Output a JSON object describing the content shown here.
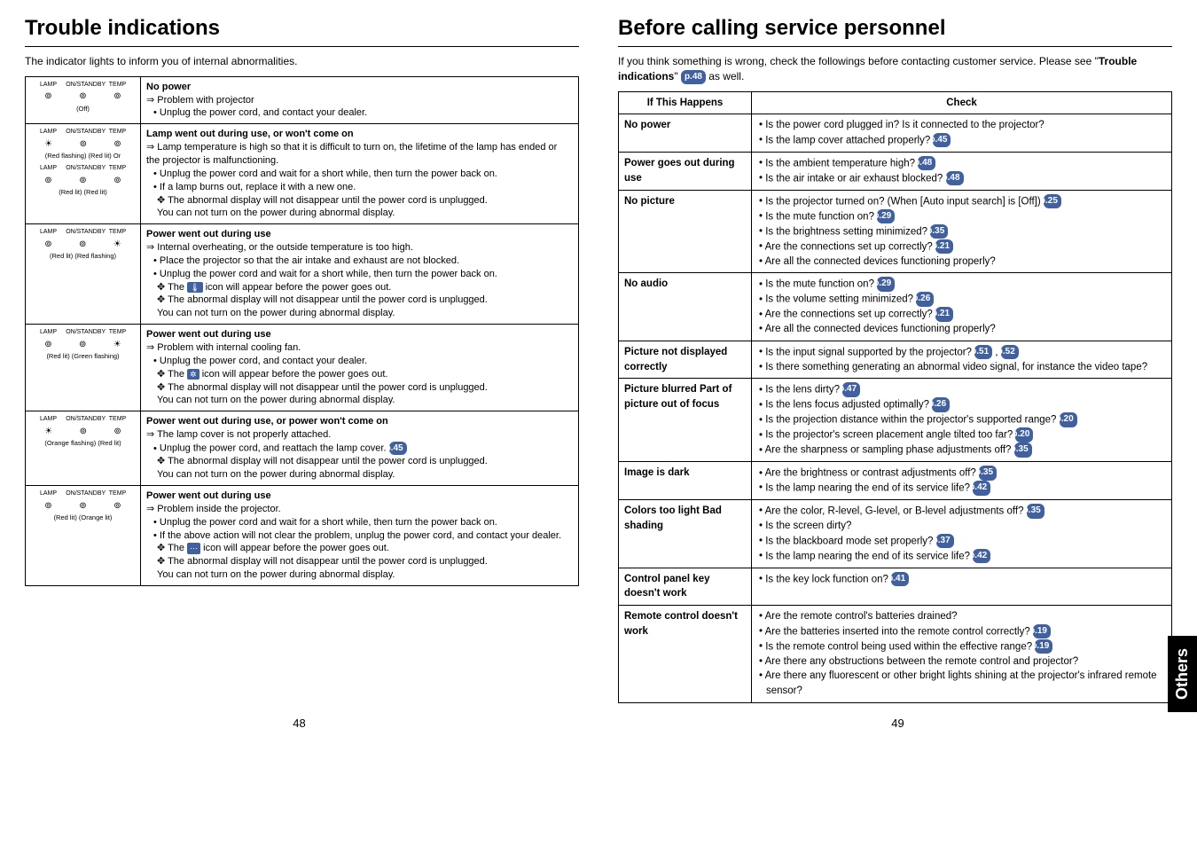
{
  "left": {
    "title": "Trouble indications",
    "intro": "The indicator lights to inform you of internal abnormalities.",
    "pagenum": "48",
    "rows": [
      {
        "lights": [
          {
            "lamp": "LAMP",
            "onst": "ON/STANDBY",
            "temp": "TEMP",
            "l": "⊚",
            "o": "⊚",
            "t": "⊚",
            "state": "(Off)"
          }
        ],
        "heading": "No power",
        "lines": [
          {
            "type": "arrow",
            "text": "Problem with projector"
          },
          {
            "type": "bullet",
            "text": "Unplug the power cord, and contact your dealer."
          }
        ]
      },
      {
        "lights": [
          {
            "lamp": "LAMP",
            "onst": "ON/STANDBY",
            "temp": "TEMP",
            "l": "☀",
            "o": "⊚",
            "t": "⊚",
            "state": "(Red flashing) (Red lit) Or"
          },
          {
            "lamp": "LAMP",
            "onst": "ON/STANDBY",
            "temp": "TEMP",
            "l": "⊚",
            "o": "⊚",
            "t": "⊚",
            "state": "(Red lit) (Red lit)"
          }
        ],
        "heading": "Lamp went out during use, or won't come on",
        "lines": [
          {
            "type": "arrow",
            "text": "Lamp temperature is high so that it is difficult to turn on, the lifetime of the lamp has ended or the projector is malfunctioning."
          },
          {
            "type": "bullet",
            "text": "Unplug the power cord and wait for a short while, then turn the power back on."
          },
          {
            "type": "bullet",
            "text": "If a lamp burns out, replace it with a new one."
          },
          {
            "type": "note",
            "text": "The abnormal display will not disappear until the power cord is unplugged."
          },
          {
            "type": "plain",
            "text": "You can not turn on the power during abnormal display."
          }
        ]
      },
      {
        "lights": [
          {
            "lamp": "LAMP",
            "onst": "ON/STANDBY",
            "temp": "TEMP",
            "l": "⊚",
            "o": "⊚",
            "t": "☀",
            "state": "(Red lit) (Red flashing)"
          }
        ],
        "heading": "Power went out during use",
        "lines": [
          {
            "type": "arrow",
            "text": "Internal overheating, or the outside temperature is too high."
          },
          {
            "type": "bullet",
            "text": "Place the projector so that the air intake and exhaust are not blocked."
          },
          {
            "type": "bullet",
            "text": "Unplug the power cord and wait for a short while, then turn the power back on."
          },
          {
            "type": "note-icon",
            "icon": "🌡",
            "text": "icon will appear before the power goes out."
          },
          {
            "type": "note",
            "text": "The abnormal display will not disappear until the power cord is unplugged."
          },
          {
            "type": "plain",
            "text": "You can not turn on the power during abnormal display."
          }
        ]
      },
      {
        "lights": [
          {
            "lamp": "LAMP",
            "onst": "ON/STANDBY",
            "temp": "TEMP",
            "l": "⊚",
            "o": "⊚",
            "t": "☀",
            "state": "(Red lit) (Green flashing)"
          }
        ],
        "heading": "Power went out during use",
        "lines": [
          {
            "type": "arrow",
            "text": "Problem with internal cooling fan."
          },
          {
            "type": "bullet",
            "text": "Unplug the power cord, and contact your dealer."
          },
          {
            "type": "note-icon",
            "icon": "✲",
            "text": "icon will appear before the power goes out."
          },
          {
            "type": "note",
            "text": "The abnormal display will not disappear until the power cord is unplugged."
          },
          {
            "type": "plain",
            "text": "You can not turn on the power during abnormal display."
          }
        ]
      },
      {
        "lights": [
          {
            "lamp": "LAMP",
            "onst": "ON/STANDBY",
            "temp": "TEMP",
            "l": "☀",
            "o": "⊚",
            "t": "⊚",
            "state": "(Orange flashing) (Red lit)"
          }
        ],
        "heading": "Power went out during use, or power won't come on",
        "lines": [
          {
            "type": "arrow",
            "text": "The lamp cover is not properly attached."
          },
          {
            "type": "bullet-ref",
            "text": "Unplug the power cord, and reattach the lamp cover.",
            "ref": "p.45"
          },
          {
            "type": "note",
            "text": "The abnormal display will not disappear until the power cord is unplugged."
          },
          {
            "type": "plain",
            "text": "You can not turn on the power during abnormal display."
          }
        ]
      },
      {
        "lights": [
          {
            "lamp": "LAMP",
            "onst": "ON/STANDBY",
            "temp": "TEMP",
            "l": "⊚",
            "o": "⊚",
            "t": "⊚",
            "state": "(Red lit) (Orange lit)"
          }
        ],
        "heading": "Power went out during use",
        "lines": [
          {
            "type": "arrow",
            "text": "Problem inside the projector."
          },
          {
            "type": "bullet",
            "text": "Unplug the power cord and wait for a short while, then turn the power back on."
          },
          {
            "type": "bullet",
            "text": "If the above action will not clear the problem, unplug  the power cord, and contact your dealer."
          },
          {
            "type": "note-icon",
            "icon": "⋯",
            "text": "icon will appear before the power goes out."
          },
          {
            "type": "note",
            "text": "The abnormal display will not disappear until the power cord is unplugged."
          },
          {
            "type": "plain",
            "text": "You can not turn on the power during abnormal display."
          }
        ]
      }
    ]
  },
  "right": {
    "title": "Before calling service personnel",
    "intro_pre": "If you think something is wrong, check the followings before contacting customer service. Please see \"",
    "intro_bold": "Trouble indications",
    "intro_post": "\" ",
    "intro_ref": "p.48",
    "intro_end": " as well.",
    "pagenum": "49",
    "sidetab": "Others",
    "th1": "If  This Happens",
    "th2": "Check",
    "rows": [
      {
        "symptom": "No power",
        "checks": [
          {
            "text": "Is the power cord plugged in? Is it connected to the projector?"
          },
          {
            "text": "Is the lamp cover attached properly?",
            "ref": "p.45"
          }
        ]
      },
      {
        "symptom": "Power goes out during use",
        "checks": [
          {
            "text": "Is the ambient temperature high?",
            "ref": "p.48"
          },
          {
            "text": "Is the air intake or air exhaust blocked?",
            "ref": "p.48"
          }
        ]
      },
      {
        "symptom": "No picture",
        "checks": [
          {
            "text": "Is the projector turned on? (When [Auto input search] is [Off])",
            "ref": "p.25"
          },
          {
            "text": "Is the mute function on?",
            "ref": "p.29"
          },
          {
            "text": "Is the brightness setting minimized?",
            "ref": "p.35"
          },
          {
            "text": "Are the connections set up correctly?",
            "ref": "p.21"
          },
          {
            "text": "Are all the connected devices functioning properly?"
          }
        ]
      },
      {
        "symptom": "No audio",
        "checks": [
          {
            "text": "Is the mute function on?",
            "ref": "p.29"
          },
          {
            "text": "Is the volume setting minimized?",
            "ref": "p.26"
          },
          {
            "text": "Are the connections set up correctly?",
            "ref": "p.21"
          },
          {
            "text": "Are all the connected devices functioning properly?"
          }
        ]
      },
      {
        "symptom": "Picture not displayed correctly",
        "checks": [
          {
            "text": "Is the input signal supported by the projector?",
            "ref": "p.51",
            "ref2": "p.52"
          },
          {
            "text": "Is there something generating an abnormal video signal, for instance the video tape?"
          }
        ]
      },
      {
        "symptom": "Picture blurred Part of picture out of focus",
        "checks": [
          {
            "text": "Is the lens dirty?",
            "ref": "p.47"
          },
          {
            "text": "Is the lens focus adjusted optimally?",
            "ref": "p.26"
          },
          {
            "text": "Is the projection distance within the projector's supported range?",
            "ref": "p.20"
          },
          {
            "text": "Is the projector's screen placement angle tilted too far?",
            "ref": "p.20"
          },
          {
            "text": "Are the sharpness or sampling phase adjustments off?",
            "ref": "p.35"
          }
        ]
      },
      {
        "symptom": "Image is dark",
        "checks": [
          {
            "text": "Are the brightness or contrast adjustments off?",
            "ref": "p.35"
          },
          {
            "text": "Is the lamp nearing the end of its service life?",
            "ref": "p.42"
          }
        ]
      },
      {
        "symptom": "Colors too light Bad shading",
        "checks": [
          {
            "text": "Are the color, R-level, G-level, or B-level adjustments off?",
            "ref": "p.35"
          },
          {
            "text": "Is the screen dirty?"
          },
          {
            "text": "Is the blackboard mode set properly?",
            "ref": "p.37"
          },
          {
            "text": "Is the lamp nearing the end of its service life?",
            "ref": "p.42"
          }
        ]
      },
      {
        "symptom": "Control panel key doesn't work",
        "checks": [
          {
            "text": "Is the key lock function on?",
            "ref": "p.41"
          }
        ]
      },
      {
        "symptom": "Remote control doesn't work",
        "checks": [
          {
            "text": "Are the remote control's batteries drained?"
          },
          {
            "text": "Are the batteries inserted into the remote control correctly?",
            "ref": "p.19"
          },
          {
            "text": "Is the remote control being used within the effective range?",
            "ref": "p.19"
          },
          {
            "text": "Are there any obstructions between the remote control and projector?"
          },
          {
            "text": "Are there any fluorescent or other bright lights shining at the projector's infrared remote sensor?"
          }
        ]
      }
    ]
  }
}
